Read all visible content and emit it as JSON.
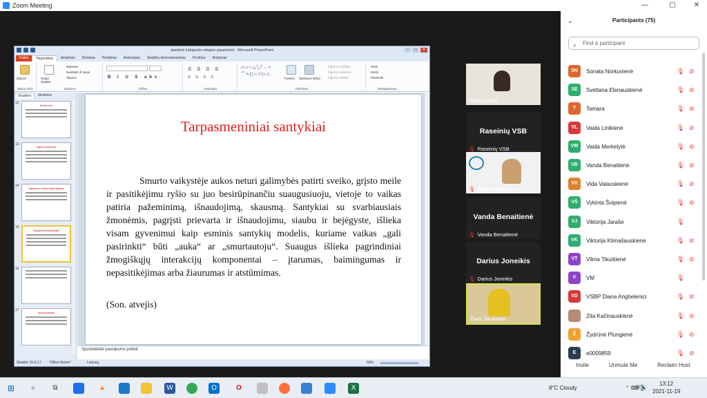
{
  "zoom": {
    "title": "Zoom Meeting"
  },
  "ppt": {
    "doc_title": "skaidrės žalojančio elegsio pasekmėd - Microsoft PowerPoint",
    "tabs": [
      "Failas",
      "Pagrindinis",
      "Įterpimas",
      "Dizainas",
      "Perėjimai",
      "Animacijos",
      "Skaidrių demonstravimas",
      "Peržiūra",
      "Rodymas"
    ],
    "ribbon": {
      "paste": "Įklijuoti",
      "new_slide": "Nauja skaidrė",
      "layout": "Maketas",
      "reset": "Nustatyti iš naujo",
      "section": "Skyrius",
      "arrange": "Tvarkyti",
      "quick_styles": "Spartusis stilius",
      "shape_fill": "Figūros užpildas",
      "shape_outline": "Figūros kontūras",
      "shape_effects": "Figūros efektai",
      "find": "Rasti",
      "replace": "Keisti",
      "select": "Pasirinkti",
      "groups": [
        "Mainų sritis",
        "Skaidrės",
        "Šriftas",
        "Pastraipa",
        "Piešimas",
        "Redagavimas"
      ]
    },
    "pane_tabs": [
      "Skaidrės",
      "Struktūra"
    ],
    "thumbs": [
      {
        "num": "12",
        "title": "Smurto ratu"
      },
      {
        "num": "13",
        "title": "Elgesio problemos"
      },
      {
        "num": "14",
        "title": "Agresyvus ir linkęs žaloti elgesys"
      },
      {
        "num": "15",
        "title": "Tarpasmeniniai santykiai"
      },
      {
        "num": "16",
        "title": ""
      },
      {
        "num": "17",
        "title": "Apibendrinimas"
      }
    ],
    "slide": {
      "title": "Tarpasmeniniai santykiai",
      "body": "Smurto vaikystėje aukos neturi galimybės patirti sveiko, grįsto meile ir pasitikėjimu ryšio su juo besirūpinančiu suaugusiuoju, vietoje to vaikas patiria pažeminimą, išnaudojimą, skausmą. Santykiai su svarbiausiais žmonėmis, pagrįsti prievarta ir išnaudojimu, siaubu ir bejėgyste, išlieka visam gyvenimui kaip esminis santykių modelis, kuriame vaikas „gali pasirinkti“ būti „auka“ ar „smurtautoju“. Suaugus išlieka pagrindiniai žmogiškųjų interakcijų komponentai – įtarumas, baimingumas ir nepasitikėjimas arba žiaurumas ir atstūmimas.",
      "case": "(Son. atvejis)"
    },
    "notes_placeholder": "Spustelėkite pastaboms pridėti",
    "status": {
      "slide": "Skaidrė 15 iš 17",
      "theme": "\"Office theme\"",
      "lang": "Lietuvių",
      "zoom": "60%"
    }
  },
  "tiles": [
    {
      "name": "Jolita Grityte",
      "big": "",
      "muted": false
    },
    {
      "name": "Raseinių VSB",
      "big": "Raseinių VSB",
      "muted": true
    },
    {
      "name": "Asta Montvydienė",
      "big": "",
      "muted": true
    },
    {
      "name": "Vanda Benaitienė",
      "big": "Vanda Benaitienė",
      "muted": true
    },
    {
      "name": "Darius Joneikis",
      "big": "Darius Joneikis",
      "muted": true
    },
    {
      "name": "Živilė Šliuikienė",
      "big": "",
      "muted": false
    }
  ],
  "participants": {
    "title": "Participants (75)",
    "search_placeholder": "Find a participant",
    "list": [
      {
        "initials": "SN",
        "name": "Sonata Norkuvienė",
        "color": "#e0662f"
      },
      {
        "initials": "SE",
        "name": "Svetlana Elenauskienė",
        "color": "#2fae6e"
      },
      {
        "initials": "T",
        "name": "Tamara",
        "color": "#e0662f"
      },
      {
        "initials": "VL",
        "name": "Vaida Linikienė",
        "color": "#d63a3a"
      },
      {
        "initials": "VM",
        "name": "Vaida Merkelytė",
        "color": "#2fae6e"
      },
      {
        "initials": "VB",
        "name": "Vanda Benaitienė",
        "color": "#2fae6e"
      },
      {
        "initials": "VV",
        "name": "Vida Valauskienė",
        "color": "#e0832f"
      },
      {
        "initials": "VŠ",
        "name": "Vykinta Švipienė",
        "color": "#2fae6e"
      },
      {
        "initials": "VJ",
        "name": "Viktorija Jaraše",
        "color": "#2fae6e"
      },
      {
        "initials": "VK",
        "name": "Viktorija Klimašauskienė",
        "color": "#2fae6e"
      },
      {
        "initials": "VT",
        "name": "Vilma Tikuišienė",
        "color": "#8e44c9"
      },
      {
        "initials": "V",
        "name": "VM",
        "color": "#8e44c9"
      },
      {
        "initials": "VD",
        "name": "VSBP Diana Anghelenici",
        "color": "#d63a3a"
      },
      {
        "initials": "",
        "name": "Zita Kačinauskienė",
        "color": "#b88a78"
      },
      {
        "initials": "Ž",
        "name": "Žydrūnė Plungienė",
        "color": "#f0a22f"
      },
      {
        "initials": "E",
        "name": "e0009859",
        "color": "#2c3e50"
      }
    ],
    "buttons": [
      "Invite",
      "Unmute Me",
      "Reclaim Host"
    ]
  },
  "taskbar": {
    "weather": "8°C  Cloudy",
    "lang": "LIT",
    "time": "13:12",
    "date": "2021-11-19"
  }
}
